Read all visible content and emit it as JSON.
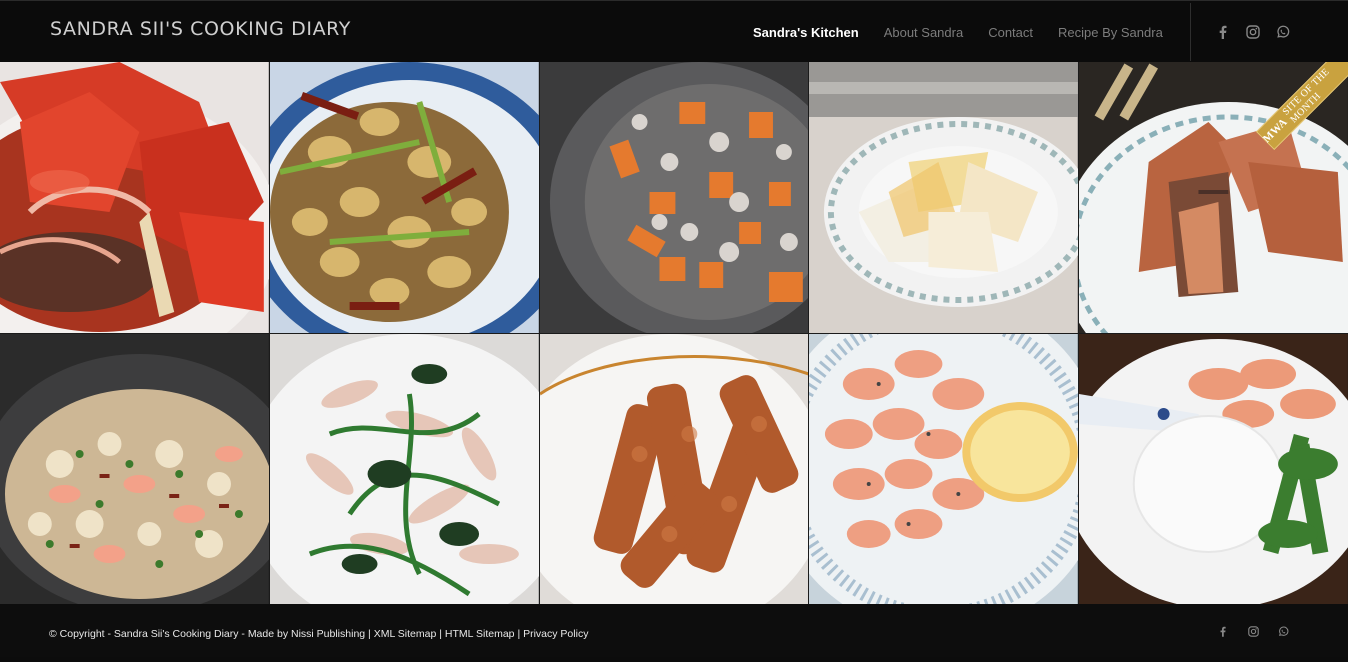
{
  "header": {
    "logo": "SANDRA SII'S COOKING DIARY",
    "nav": [
      {
        "label": "Sandra's Kitchen",
        "active": true
      },
      {
        "label": "About Sandra",
        "active": false
      },
      {
        "label": "Contact",
        "active": false
      },
      {
        "label": "Recipe By Sandra",
        "active": false
      }
    ],
    "social_icons": [
      "facebook-icon",
      "instagram-icon",
      "whatsapp-icon"
    ]
  },
  "gallery": {
    "badge": {
      "brand": "MWA",
      "text": "SITE OF THE MONTH"
    },
    "tiles": [
      {
        "subject": "sweet and sour fish with tomato"
      },
      {
        "subject": "kung pao chicken"
      },
      {
        "subject": "chicken with carrots in wok"
      },
      {
        "subject": "fried egg pancake"
      },
      {
        "subject": "pan-fried salmon"
      },
      {
        "subject": "shrimp fried rice"
      },
      {
        "subject": "stir-fried chicken with greens"
      },
      {
        "subject": "fried pork strips"
      },
      {
        "subject": "garlic shrimp with lemon"
      },
      {
        "subject": "shrimp, rice and greens"
      }
    ]
  },
  "footer": {
    "copyright": "© Copyright - Sandra Sii's Cooking Diary - Made by Nissi Publishing",
    "links": [
      "XML Sitemap",
      "HTML Sitemap",
      "Privacy Policy"
    ],
    "separator": " | "
  },
  "colors": {
    "accent_badge": "#c9a23f",
    "background": "#0b0b0b",
    "nav_active": "#ffffff",
    "nav_inactive": "#7c7c7c"
  }
}
